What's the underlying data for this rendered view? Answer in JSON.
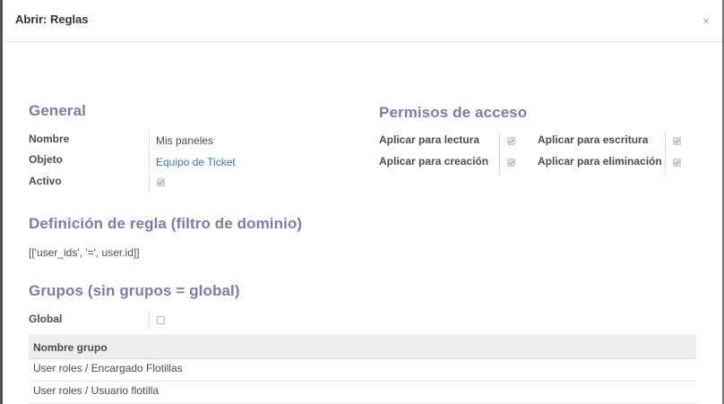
{
  "dialog": {
    "title": "Abrir: Reglas",
    "close_label": "×"
  },
  "general": {
    "title": "General",
    "name_label": "Nombre",
    "name_value": "Mis paneles",
    "object_label": "Objeto",
    "object_value": "Equipo de Ticket",
    "active_label": "Activo",
    "active_checked": true
  },
  "permissions": {
    "title": "Permisos de acceso",
    "read_label": "Aplicar para lectura",
    "read_checked": true,
    "write_label": "Aplicar para escritura",
    "write_checked": true,
    "create_label": "Aplicar para creación",
    "create_checked": true,
    "delete_label": "Aplicar para eliminación",
    "delete_checked": true
  },
  "domain": {
    "title": "Definición de regla (filtro de dominio)",
    "value": "[['user_ids', '=', user.id]]"
  },
  "groups": {
    "title": "Grupos (sin grupos = global)",
    "global_label": "Global",
    "global_checked": false,
    "column_header": "Nombre grupo",
    "rows": [
      "User roles / Encargado Flotillas",
      "User roles / Usuario flotilla"
    ]
  }
}
